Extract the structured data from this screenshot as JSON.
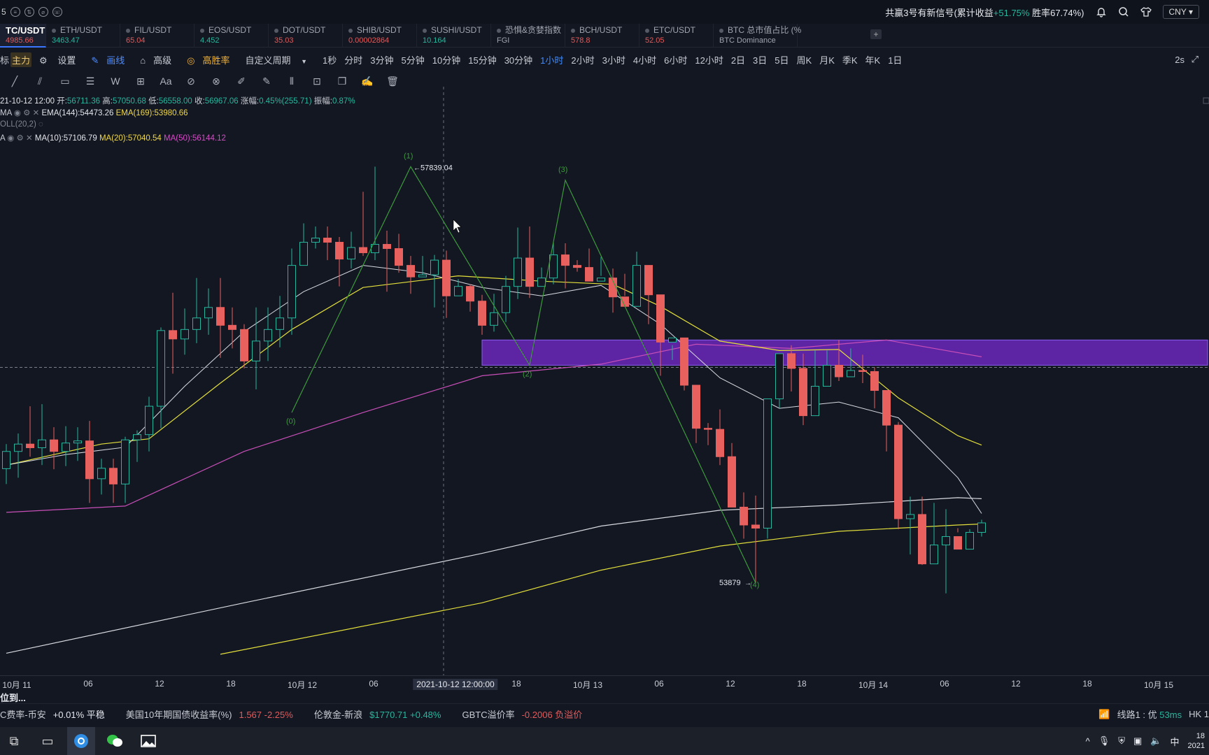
{
  "topbar": {
    "left_num": "5",
    "signal_prefix": "共赢3号有新信号(累计收益",
    "signal_gain": "+51.75%",
    "signal_suffix": "胜率67.74%)",
    "currency": "CNY"
  },
  "tickers": [
    {
      "name": "TC/USDT",
      "value": "4985.66",
      "dir": "dn",
      "active": true
    },
    {
      "name": "ETH/USDT",
      "value": "3463.47",
      "dir": "up"
    },
    {
      "name": "FIL/USDT",
      "value": "65.04",
      "dir": "dn"
    },
    {
      "name": "EOS/USDT",
      "value": "4.452",
      "dir": "up"
    },
    {
      "name": "DOT/USDT",
      "value": "35.03",
      "dir": "dn"
    },
    {
      "name": "SHIB/USDT",
      "value": "0.00002864",
      "dir": "dn"
    },
    {
      "name": "SUSHI/USDT",
      "value": "10.164",
      "dir": "up"
    },
    {
      "name": "恐惧&贪婪指数",
      "value": "FGI",
      "dir": "none"
    },
    {
      "name": "BCH/USDT",
      "value": "578.8",
      "dir": "dn"
    },
    {
      "name": "ETC/USDT",
      "value": "52.05",
      "dir": "dn"
    },
    {
      "name": "BTC 总市值占比 (%",
      "value": "BTC Dominance",
      "dir": "none"
    }
  ],
  "periods": {
    "label_a": "标",
    "main": "主力",
    "settings": "设置",
    "draw": "画线",
    "advanced": "高级",
    "winrate": "高胜率",
    "custom": "自定义周期",
    "items": [
      "1秒",
      "分时",
      "3分钟",
      "5分钟",
      "10分钟",
      "15分钟",
      "30分钟",
      "1小时",
      "2小时",
      "3小时",
      "4小时",
      "6小时",
      "12小时",
      "2日",
      "3日",
      "5日",
      "周K",
      "月K",
      "季K",
      "年K",
      "1日"
    ],
    "selected": "1小时",
    "right": "2s"
  },
  "info": {
    "ohlc_date": "21-10-12 12:00",
    "open_label": "开:",
    "open": "56711.36",
    "high_label": "高:",
    "high": "57050.68",
    "low_label": "低:",
    "low": "56558.00",
    "close_label": "收:",
    "close": "56967.06",
    "chg_label": "涨幅:",
    "chg": "0.45%(255.71)",
    "amp_label": "振幅:",
    "amp": "0.87%",
    "ema_tag": "MA",
    "ema144": "EMA(144):54473.26",
    "ema169": "EMA(169):53980.66",
    "boll": "OLL(20,2)",
    "ma_tag": "A",
    "ma10": "MA(10):57106.79",
    "ma20": "MA(20):57040.54",
    "ma50": "MA(50):56144.12"
  },
  "annotations": {
    "high_label": "57839.04",
    "low_label": "53879",
    "wave_0": "(0)",
    "wave_1": "(1)",
    "wave_2": "(2)",
    "wave_3": "(3)",
    "wave_4": "(4)"
  },
  "xaxis": {
    "labels": [
      "10月 11",
      "06",
      "12",
      "18",
      "10月 12",
      "06",
      "2021-10-12 12:00:00",
      "18",
      "10月 13",
      "06",
      "12",
      "18",
      "10月 14",
      "06",
      "12",
      "18",
      "10月 15"
    ]
  },
  "loading_text": "位到...",
  "bottombar": {
    "items": [
      {
        "label": "C费率-币安",
        "value": "+0.01% 平稳",
        "dir": "flat"
      },
      {
        "label": "美国10年期国债收益率(%)",
        "value": "1.567  -2.25%",
        "dir": "dn"
      },
      {
        "label": "伦敦金-新浪",
        "value": "$1770.71  +0.48%",
        "dir": "up"
      },
      {
        "label": "GBTC溢价率",
        "value": "-0.2006  负溢价",
        "dir": "dn"
      }
    ],
    "route": "线路1 : 优",
    "latency": "53ms",
    "hk": "HK 1"
  },
  "taskbar": {
    "ime": "中",
    "clock_top": "18",
    "clock_bottom": "2021"
  },
  "chart_data": {
    "type": "candlestick",
    "price_range": [
      53000,
      58600
    ],
    "reference_price": 55930,
    "x_range_hours": [
      0,
      104
    ],
    "time_start": "2021-10-11 00:00",
    "candles": [
      [
        0,
        54966,
        55130,
        54820,
        55200
      ],
      [
        1,
        55130,
        55200,
        54880,
        55300
      ],
      [
        2,
        55200,
        55165,
        55080,
        55560
      ],
      [
        3,
        55165,
        55240,
        55000,
        55580
      ],
      [
        4,
        55240,
        55130,
        54960,
        55360
      ],
      [
        5,
        55130,
        55210,
        54990,
        55370
      ],
      [
        6,
        55210,
        55230,
        55040,
        55360
      ],
      [
        7,
        55230,
        54870,
        54640,
        55420
      ],
      [
        8,
        54870,
        54970,
        54720,
        55060
      ],
      [
        9,
        54970,
        54820,
        54640,
        55060
      ],
      [
        10,
        54820,
        55240,
        54640,
        55270
      ],
      [
        11,
        55240,
        55290,
        55030,
        55330
      ],
      [
        12,
        55290,
        55560,
        55130,
        55650
      ],
      [
        13,
        55560,
        56280,
        55350,
        56310
      ],
      [
        14,
        56280,
        56200,
        55870,
        56640
      ],
      [
        15,
        56200,
        56290,
        56050,
        56490
      ],
      [
        16,
        56290,
        56400,
        56160,
        56780
      ],
      [
        17,
        56400,
        56500,
        56240,
        56680
      ],
      [
        18,
        56500,
        56330,
        56020,
        56780
      ],
      [
        19,
        56330,
        56290,
        56110,
        56500
      ],
      [
        20,
        56290,
        55990,
        55920,
        56340
      ],
      [
        21,
        55990,
        56180,
        55720,
        56500
      ],
      [
        22,
        56180,
        56290,
        55990,
        56500
      ],
      [
        23,
        56290,
        56400,
        56120,
        56610
      ],
      [
        24,
        56400,
        56900,
        56240,
        57060
      ],
      [
        25,
        56900,
        57120,
        56950,
        57300
      ],
      [
        26,
        57120,
        57160,
        57060,
        57270
      ],
      [
        27,
        57160,
        57120,
        56950,
        57270
      ],
      [
        28,
        57120,
        56960,
        56700,
        57170
      ],
      [
        29,
        56960,
        57070,
        56870,
        57220
      ],
      [
        30,
        57070,
        57020,
        56990,
        57600
      ],
      [
        31,
        57020,
        57100,
        56950,
        57839
      ],
      [
        32,
        57100,
        57060,
        56650,
        57230
      ],
      [
        33,
        57060,
        56900,
        56830,
        57200
      ],
      [
        34,
        56900,
        56790,
        56630,
        56990
      ],
      [
        35,
        56790,
        56810,
        56790,
        56990
      ],
      [
        36,
        56810,
        56950,
        56500,
        57000
      ],
      [
        37,
        56950,
        56610,
        56400,
        57040
      ],
      [
        38,
        56610,
        56700,
        56630,
        56770
      ],
      [
        39,
        56700,
        56560,
        56460,
        56720
      ],
      [
        40,
        56560,
        56330,
        56240,
        56620
      ],
      [
        41,
        56330,
        56450,
        56270,
        56630
      ],
      [
        42,
        56450,
        56700,
        56360,
        56800
      ],
      [
        43,
        56700,
        56970,
        56580,
        57260
      ],
      [
        44,
        56970,
        56700,
        56590,
        57270
      ],
      [
        45,
        56700,
        56780,
        56720,
        56880
      ],
      [
        46,
        56780,
        57000,
        56720,
        57120
      ],
      [
        47,
        57000,
        56900,
        56680,
        57110
      ],
      [
        48,
        56900,
        56880,
        56840,
        56950
      ],
      [
        49,
        56880,
        56750,
        56830,
        57060
      ],
      [
        50,
        56750,
        56780,
        56800,
        56980
      ],
      [
        51,
        56780,
        56600,
        56450,
        56870
      ],
      [
        52,
        56600,
        56510,
        56610,
        56820
      ],
      [
        53,
        56510,
        56900,
        56570,
        57030
      ],
      [
        54,
        56900,
        56620,
        56340,
        56900
      ],
      [
        55,
        56620,
        56170,
        55850,
        56600
      ],
      [
        56,
        56170,
        56210,
        56000,
        56140
      ],
      [
        57,
        56210,
        55760,
        55710,
        56210
      ],
      [
        58,
        55760,
        55350,
        55210,
        55750
      ],
      [
        59,
        55350,
        55340,
        55190,
        55400
      ],
      [
        60,
        55340,
        55080,
        55000,
        55530
      ],
      [
        61,
        55080,
        54600,
        54630,
        55210
      ],
      [
        62,
        54600,
        54430,
        54300,
        54740
      ],
      [
        63,
        54430,
        54400,
        53879,
        54710
      ],
      [
        64,
        54400,
        55630,
        54300,
        55300
      ],
      [
        65,
        55630,
        56060,
        55540,
        56060
      ],
      [
        66,
        56060,
        55920,
        55700,
        56140
      ],
      [
        67,
        55920,
        55470,
        55380,
        56060
      ],
      [
        68,
        55470,
        55750,
        55680,
        56090
      ],
      [
        69,
        55750,
        55950,
        55920,
        56090
      ],
      [
        70,
        55950,
        55840,
        55800,
        56190
      ],
      [
        71,
        55840,
        55900,
        55880,
        56110
      ],
      [
        72,
        55900,
        55890,
        55780,
        56050
      ],
      [
        73,
        55890,
        55710,
        55540,
        55930
      ],
      [
        74,
        55710,
        55380,
        55130,
        55490
      ],
      [
        75,
        55380,
        54490,
        54390,
        55410
      ],
      [
        76,
        54490,
        54530,
        54150,
        54700
      ],
      [
        77,
        54530,
        54060,
        54050,
        54700
      ],
      [
        78,
        54060,
        54240,
        54110,
        54640
      ],
      [
        79,
        54240,
        54320,
        53780,
        54580
      ],
      [
        80,
        54320,
        54200,
        54400,
        54360
      ],
      [
        81,
        54200,
        54360,
        54280,
        54390
      ],
      [
        82,
        54360,
        54450,
        54320,
        54480
      ]
    ],
    "ma10": [
      [
        0,
        55000
      ],
      [
        5,
        55100
      ],
      [
        10,
        55170
      ],
      [
        15,
        55750
      ],
      [
        20,
        56270
      ],
      [
        25,
        56650
      ],
      [
        30,
        56900
      ],
      [
        35,
        56830
      ],
      [
        40,
        56690
      ],
      [
        45,
        56610
      ],
      [
        50,
        56710
      ],
      [
        55,
        56340
      ],
      [
        60,
        55830
      ],
      [
        65,
        55540
      ],
      [
        70,
        55600
      ],
      [
        75,
        55450
      ],
      [
        80,
        54880
      ],
      [
        82,
        54540
      ]
    ],
    "ma20": [
      [
        0,
        55000
      ],
      [
        8,
        55200
      ],
      [
        12,
        55250
      ],
      [
        18,
        55780
      ],
      [
        24,
        56290
      ],
      [
        30,
        56690
      ],
      [
        38,
        56800
      ],
      [
        45,
        56750
      ],
      [
        51,
        56720
      ],
      [
        55,
        56510
      ],
      [
        60,
        56180
      ],
      [
        65,
        56090
      ],
      [
        70,
        56100
      ],
      [
        75,
        55640
      ],
      [
        80,
        55280
      ],
      [
        82,
        55190
      ]
    ],
    "ma50": [
      [
        0,
        54550
      ],
      [
        10,
        54610
      ],
      [
        20,
        55130
      ],
      [
        30,
        55500
      ],
      [
        40,
        55850
      ],
      [
        50,
        55960
      ],
      [
        58,
        56150
      ],
      [
        66,
        56110
      ],
      [
        74,
        56190
      ],
      [
        82,
        56030
      ]
    ],
    "ema144": [
      [
        0,
        53210
      ],
      [
        20,
        53690
      ],
      [
        40,
        54160
      ],
      [
        50,
        54420
      ],
      [
        60,
        54570
      ],
      [
        70,
        54620
      ],
      [
        80,
        54690
      ],
      [
        82,
        54680
      ]
    ],
    "ema169": [
      [
        18,
        53200
      ],
      [
        40,
        53690
      ],
      [
        50,
        54000
      ],
      [
        60,
        54230
      ],
      [
        70,
        54370
      ],
      [
        80,
        54430
      ],
      [
        82,
        54440
      ]
    ],
    "zigzag": [
      [
        24,
        55500
      ],
      [
        34,
        57839
      ],
      [
        44,
        55950
      ],
      [
        47,
        57710
      ],
      [
        63,
        53879
      ]
    ],
    "zone": {
      "price_top": 56190,
      "price_bottom": 55950,
      "from_hour": 40,
      "to_hour": 101
    }
  }
}
